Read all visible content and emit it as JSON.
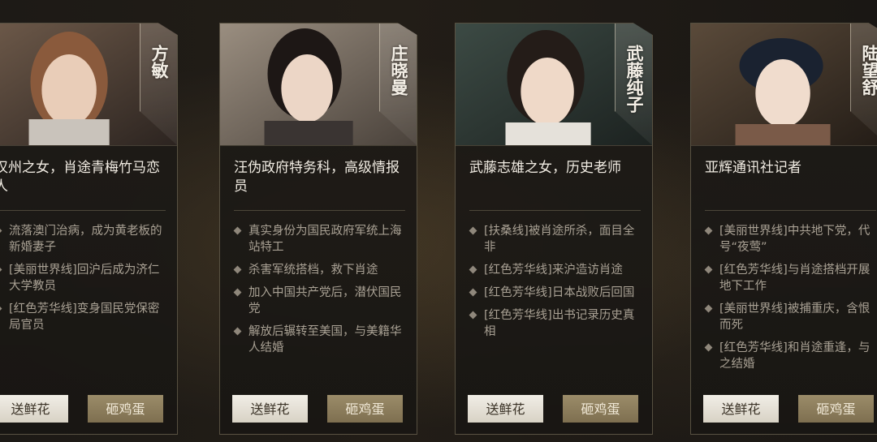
{
  "cards": [
    {
      "name": "方敏",
      "title": "汉州之女，肖途青梅竹马恋人",
      "bullets": [
        "流落澳门治病，成为黄老板的新婚妻子",
        "[美丽世界线]回沪后成为济仁大学教员",
        "[红色芳华线]变身国民党保密局官员"
      ],
      "flower_label": "送鲜花",
      "egg_label": "砸鸡蛋"
    },
    {
      "name": "庄晓曼",
      "title": "汪伪政府特务科，高级情报员",
      "bullets": [
        "真实身份为国民政府军统上海站特工",
        "杀害军统搭档，救下肖途",
        "加入中国共产党后，潜伏国民党",
        "解放后辗转至美国，与美籍华人结婚"
      ],
      "flower_label": "送鲜花",
      "egg_label": "砸鸡蛋"
    },
    {
      "name": "武藤纯子",
      "title": "武藤志雄之女，历史老师",
      "bullets": [
        "[扶桑线]被肖途所杀，面目全非",
        "[红色芳华线]来沪造访肖途",
        "[红色芳华线]日本战败后回国",
        "[红色芳华线]出书记录历史真相"
      ],
      "flower_label": "送鲜花",
      "egg_label": "砸鸡蛋"
    },
    {
      "name": "陆望舒",
      "title": "亚辉通讯社记者",
      "bullets": [
        "[美丽世界线]中共地下党，代号“夜莺”",
        "[红色芳华线]与肖途搭档开展地下工作",
        "[美丽世界线]被捕重庆，含恨而死",
        "[红色芳华线]和肖途重逢，与之结婚"
      ],
      "flower_label": "送鲜花",
      "egg_label": "砸鸡蛋"
    }
  ],
  "colors": {
    "accent_gold": "#8e7f5e",
    "flower_button": "#ece8df",
    "text_light": "#f1ece3",
    "text_muted": "#a9a194"
  }
}
